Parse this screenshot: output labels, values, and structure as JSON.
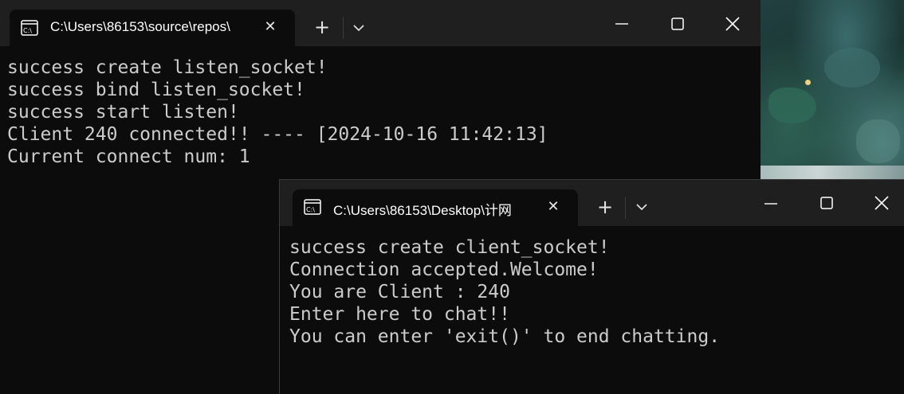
{
  "windows": [
    {
      "tab_title": "C:\\Users\\86153\\source\\repos\\",
      "lines": [
        "success create listen_socket!",
        "success bind listen_socket!",
        "success start listen!",
        "Client 240 connected!! ---- [2024-10-16 11:42:13]",
        "Current connect num: 1"
      ]
    },
    {
      "tab_title": "C:\\Users\\86153\\Desktop\\计网",
      "lines": [
        "success create client_socket!",
        "Connection accepted.Welcome!",
        "You are Client : 240",
        "Enter here to chat!!",
        "You can enter 'exit()' to end chatting."
      ]
    }
  ],
  "ui": {
    "new_tab_glyph": "+",
    "close_glyph": "✕"
  },
  "colors": {
    "console_bg": "#0c0c0c",
    "titlebar_bg": "#1f1f1f",
    "console_text": "#cccccc"
  }
}
